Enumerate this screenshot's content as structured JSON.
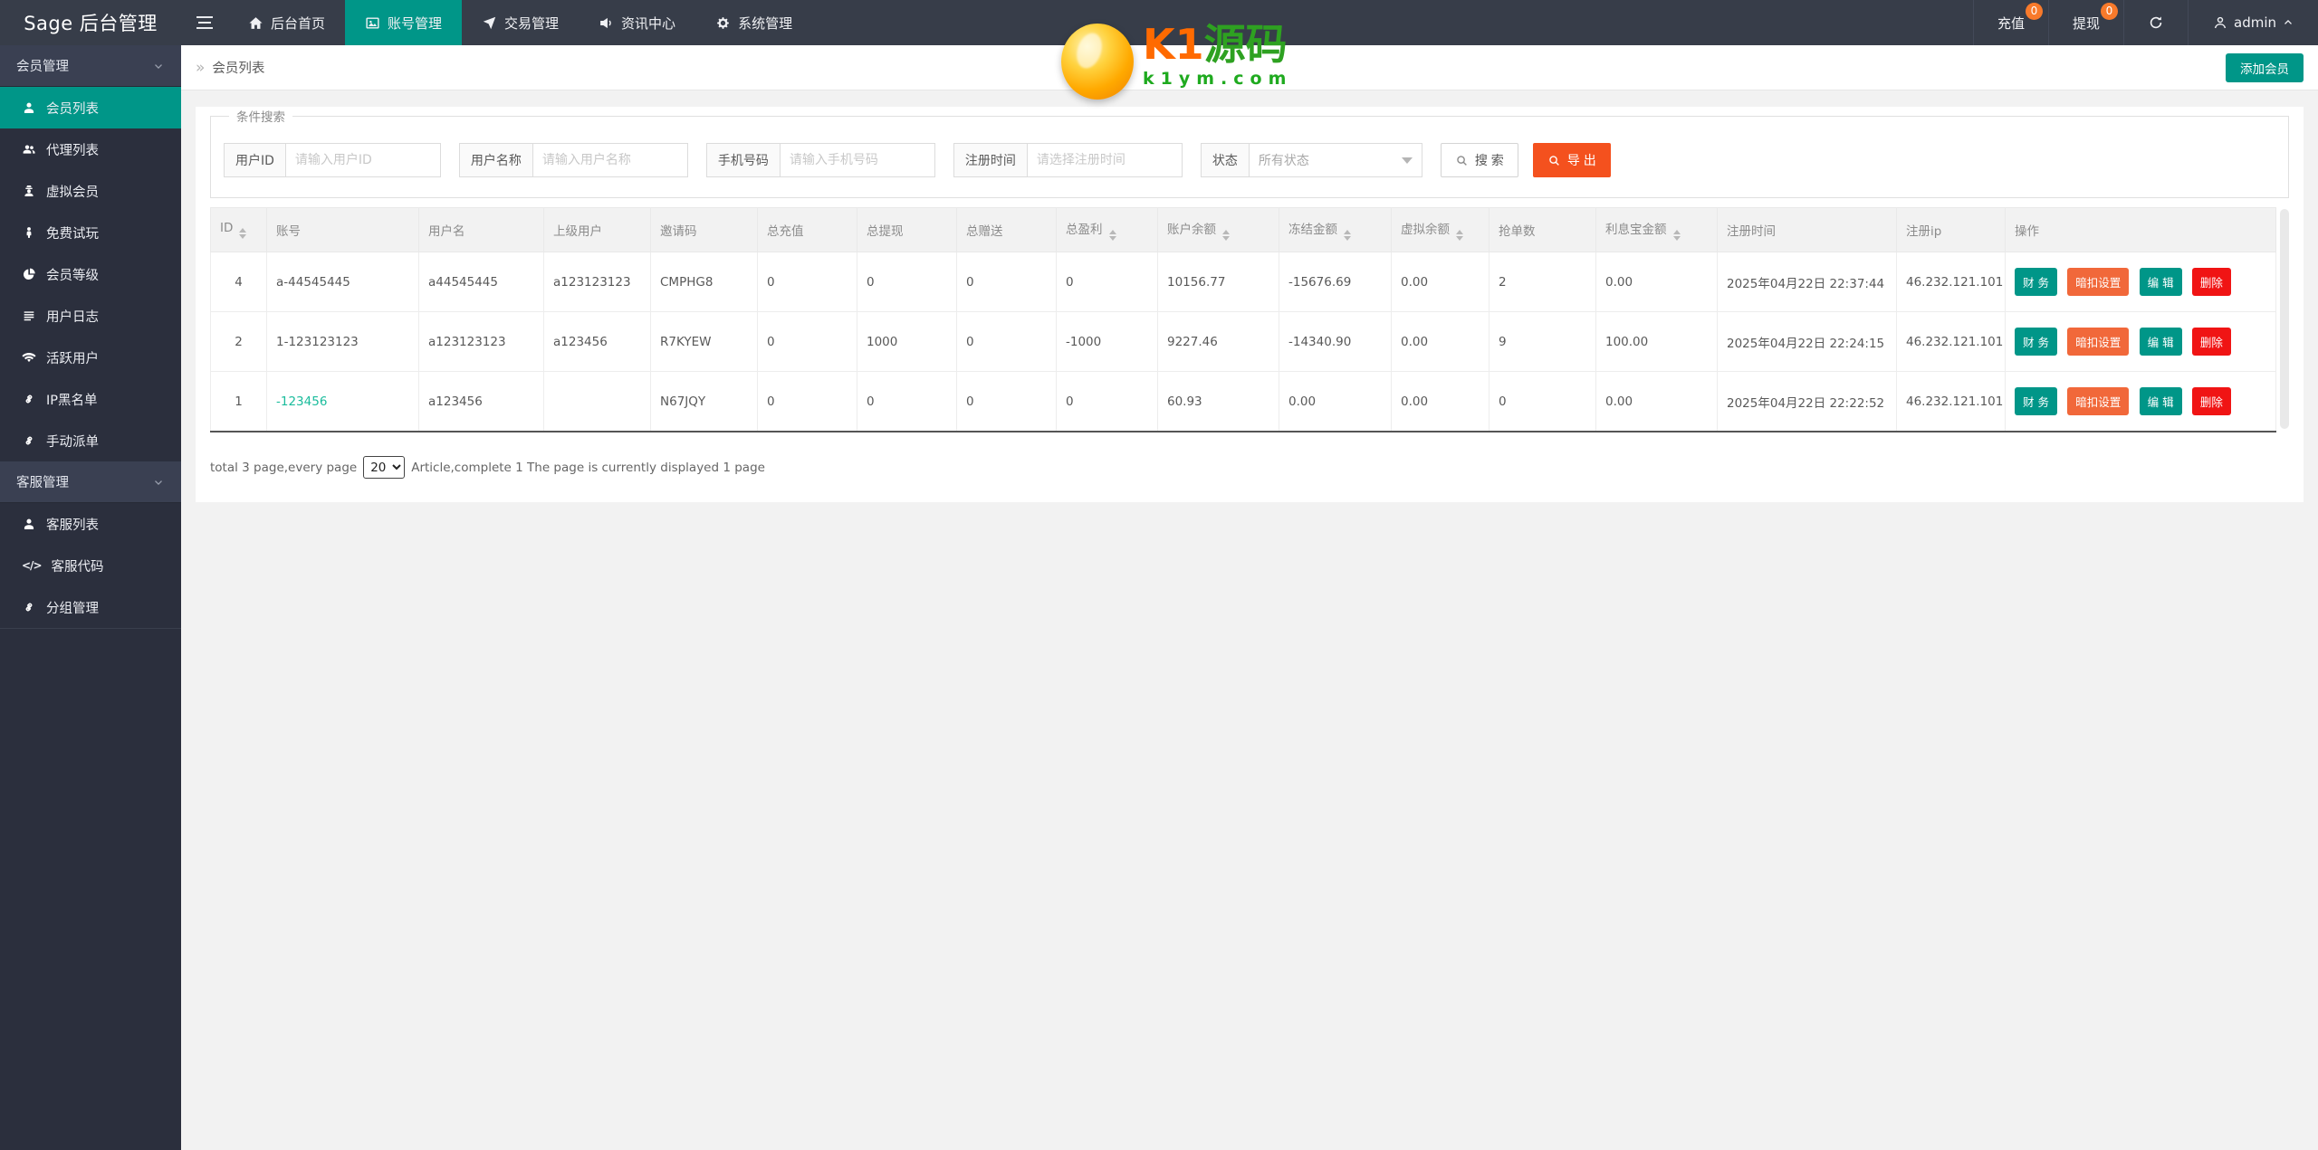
{
  "topbar": {
    "brand": "Sage 后台管理",
    "nav": [
      {
        "label": "后台首页",
        "icon": "home-icon"
      },
      {
        "label": "账号管理",
        "icon": "image-icon"
      },
      {
        "label": "交易管理",
        "icon": "send-icon"
      },
      {
        "label": "资讯中心",
        "icon": "megaphone-icon"
      },
      {
        "label": "系统管理",
        "icon": "gears-icon"
      }
    ],
    "recharge_label": "充值",
    "recharge_badge": "0",
    "withdraw_label": "提现",
    "withdraw_badge": "0",
    "user": "admin"
  },
  "watermark": {
    "title_orange": "K1",
    "title_green": "源码",
    "domain": "k1ym.com"
  },
  "sidebar": {
    "groups": [
      {
        "header": "会员管理",
        "items": [
          {
            "label": "会员列表",
            "icon": "user-icon"
          },
          {
            "label": "代理列表",
            "icon": "users-icon"
          },
          {
            "label": "虚拟会员",
            "icon": "user-secret-icon"
          },
          {
            "label": "免费试玩",
            "icon": "street-view-icon"
          },
          {
            "label": "会员等级",
            "icon": "pie-icon"
          },
          {
            "label": "用户日志",
            "icon": "list-icon"
          },
          {
            "label": "活跃用户",
            "icon": "wifi-icon"
          },
          {
            "label": "IP黑名单",
            "icon": "link-icon"
          },
          {
            "label": "手动派单",
            "icon": "link-icon"
          }
        ]
      },
      {
        "header": "客服管理",
        "items": [
          {
            "label": "客服列表",
            "icon": "user-icon"
          },
          {
            "label": "客服代码",
            "icon": "code-icon"
          },
          {
            "label": "分组管理",
            "icon": "link-icon"
          }
        ]
      }
    ]
  },
  "breadcrumb": {
    "separator": "»",
    "current": "会员列表"
  },
  "add_member_button": "添加会员",
  "search": {
    "legend": "条件搜索",
    "fields": [
      {
        "label": "用户ID",
        "placeholder": "请输入用户ID"
      },
      {
        "label": "用户名称",
        "placeholder": "请输入用户名称"
      },
      {
        "label": "手机号码",
        "placeholder": "请输入手机号码"
      },
      {
        "label": "注册时间",
        "placeholder": "请选择注册时间"
      }
    ],
    "status": {
      "label": "状态",
      "value": "所有状态"
    },
    "search_button": "搜 索",
    "export_button": "导 出"
  },
  "table": {
    "columns": [
      {
        "label": "ID"
      },
      {
        "label": "账号"
      },
      {
        "label": "用户名"
      },
      {
        "label": "上级用户"
      },
      {
        "label": "邀请码"
      },
      {
        "label": "总充值"
      },
      {
        "label": "总提现"
      },
      {
        "label": "总赠送"
      },
      {
        "label": "总盈利"
      },
      {
        "label": "账户余额"
      },
      {
        "label": "冻结金额"
      },
      {
        "label": "虚拟余额"
      },
      {
        "label": "抢单数"
      },
      {
        "label": "利息宝金额"
      },
      {
        "label": "注册时间"
      },
      {
        "label": "注册ip"
      },
      {
        "label": "操作"
      }
    ],
    "rows": [
      {
        "id": "4",
        "account": "a-44545445",
        "username": "a44545445",
        "parent": "a123123123",
        "invite": "CMPHG8",
        "recharge": "0",
        "withdraw": "0",
        "gift": "0",
        "profit": "0",
        "balance": "10156.77",
        "frozen": "-15676.69",
        "virtual": "0.00",
        "orders": "2",
        "interest": "0.00",
        "reg_time": "2025年04月22日 22:37:44",
        "reg_ip": "46.232.121.101"
      },
      {
        "id": "2",
        "account": "1-123123123",
        "username": "a123123123",
        "parent": "a123456",
        "invite": "R7KYEW",
        "recharge": "0",
        "withdraw": "1000",
        "gift": "0",
        "profit": "-1000",
        "balance": "9227.46",
        "frozen": "-14340.90",
        "virtual": "0.00",
        "orders": "9",
        "interest": "100.00",
        "reg_time": "2025年04月22日 22:24:15",
        "reg_ip": "46.232.121.101"
      },
      {
        "id": "1",
        "account": "-123456",
        "username": "a123456",
        "parent": "",
        "invite": "N67JQY",
        "recharge": "0",
        "withdraw": "0",
        "gift": "0",
        "profit": "0",
        "balance": "60.93",
        "frozen": "0.00",
        "virtual": "0.00",
        "orders": "0",
        "interest": "0.00",
        "reg_time": "2025年04月22日 22:22:52",
        "reg_ip": "46.232.121.101"
      }
    ],
    "actions": {
      "finance": "财 务",
      "hidden_deduct": "暗扣设置",
      "edit": "编 辑",
      "delete": "删除"
    }
  },
  "pagination": {
    "prefix": "total 3 page,every page",
    "page_size": "20",
    "suffix": "Article,complete 1 The page is currently displayed 1 page"
  },
  "colors": {
    "accent": "#009688",
    "export": "#f4511e",
    "orange_button": "#f1683a",
    "red_button": "#f01414",
    "badge": "#f87a2b",
    "link": "#1abc9c"
  }
}
